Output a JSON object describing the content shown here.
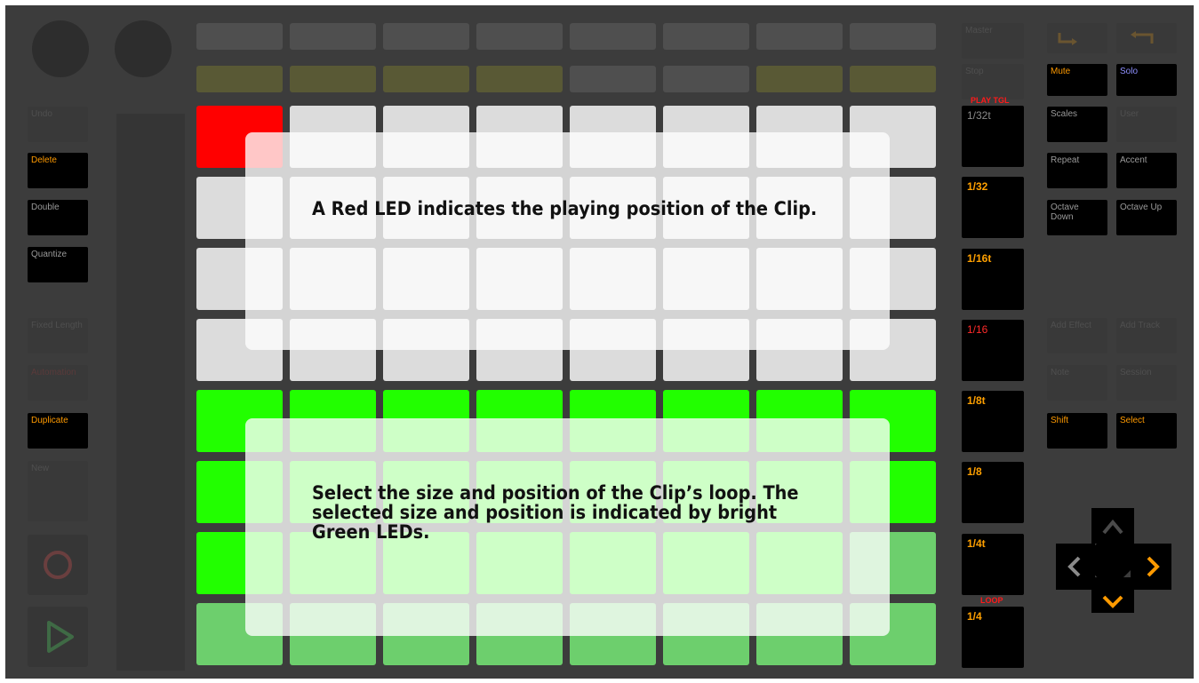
{
  "left_buttons": {
    "undo": "Undo",
    "delete": "Delete",
    "double": "Double",
    "quantize": "Quantize",
    "fixed_length": "Fixed Length",
    "automation": "Automation",
    "duplicate": "Duplicate",
    "new": "New"
  },
  "right_column": {
    "master": "Master",
    "stop": "Stop",
    "play_tgl_label": "PLAY TGL",
    "loop_label": "LOOP",
    "rates": [
      "1/32t",
      "1/32",
      "1/16t",
      "1/16",
      "1/8t",
      "1/8",
      "1/4t",
      "1/4"
    ]
  },
  "far_right": {
    "mute": "Mute",
    "solo": "Solo",
    "scales": "Scales",
    "user": "User",
    "repeat": "Repeat",
    "accent": "Accent",
    "octave_down": "Octave Down",
    "octave_up": "Octave Up",
    "add_effect": "Add Effect",
    "add_track": "Add Track",
    "note": "Note",
    "session": "Session",
    "shift": "Shift",
    "select": "Select"
  },
  "callouts": {
    "top": "A Red LED indicates the playing position of the Clip.",
    "bottom": "Select the size and position of the Clip’s loop. The selected size and position is indicated by bright Green LEDs."
  },
  "pad_grid": {
    "colors": {
      "off": "#dcdcdc",
      "playing": "#ff0000",
      "loop_bright": "#22ff00",
      "loop_dim": "#6dcf6d"
    },
    "playing_position": 1,
    "rows": [
      [
        "playing",
        "off",
        "off",
        "off",
        "off",
        "off",
        "off",
        "off"
      ],
      [
        "off",
        "off",
        "off",
        "off",
        "off",
        "off",
        "off",
        "off"
      ],
      [
        "off",
        "off",
        "off",
        "off",
        "off",
        "off",
        "off",
        "off"
      ],
      [
        "off",
        "off",
        "off",
        "off",
        "off",
        "off",
        "off",
        "off"
      ],
      [
        "bright",
        "bright",
        "bright",
        "bright",
        "bright",
        "bright",
        "bright",
        "bright"
      ],
      [
        "bright",
        "bright",
        "bright",
        "bright",
        "bright",
        "bright",
        "bright",
        "bright"
      ],
      [
        "bright",
        "bright",
        "bright",
        "bright",
        "bright",
        "bright",
        "bright",
        "dim"
      ],
      [
        "dim",
        "dim",
        "dim",
        "dim",
        "dim",
        "dim",
        "dim",
        "dim"
      ]
    ]
  },
  "top_rows": {
    "row1_color": "#4f4f4f",
    "row2_colors": [
      "#595935",
      "#595935",
      "#595935",
      "#595935",
      "#4f4f4f",
      "#4f4f4f",
      "#595935",
      "#595935"
    ]
  },
  "icons": {
    "record": "record-icon",
    "play": "play-icon",
    "undo_arrow": "undo-arrow-icon",
    "redo_arrow": "return-arrow-icon",
    "dpad": [
      "up-arrow-icon",
      "left-arrow-icon",
      "right-arrow-icon",
      "down-arrow-icon"
    ]
  }
}
